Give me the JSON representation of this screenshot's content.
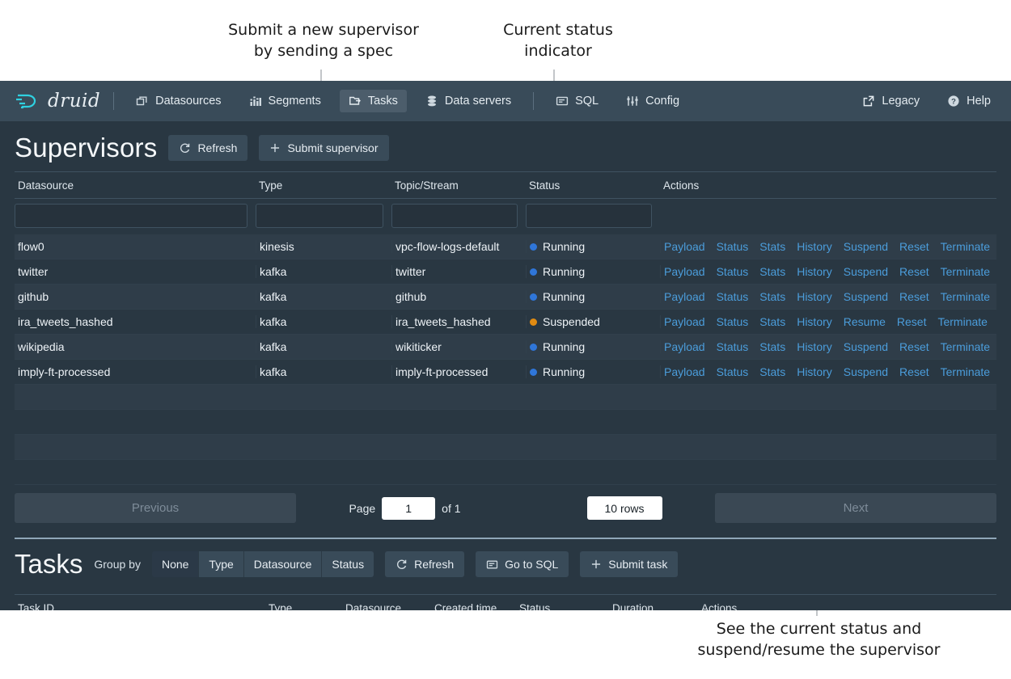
{
  "annotations": [
    {
      "id": "submit-supervisor",
      "text": "Submit a new supervisor\nby sending a spec"
    },
    {
      "id": "status-indicator",
      "text": "Current status\nindicator"
    },
    {
      "id": "suspend-resume",
      "text": "See the current status and\nsuspend/resume the supervisor"
    }
  ],
  "navbar": {
    "brand": "druid",
    "brand_logo_icon": "druid-logo-icon",
    "items": [
      {
        "label": "Datasources",
        "icon": "datasources-icon",
        "active": false
      },
      {
        "label": "Segments",
        "icon": "segments-icon",
        "active": false
      },
      {
        "label": "Tasks",
        "icon": "tasks-icon",
        "active": true
      },
      {
        "label": "Data servers",
        "icon": "data-servers-icon",
        "active": false
      },
      {
        "label": "SQL",
        "icon": "sql-icon",
        "active": false
      },
      {
        "label": "Config",
        "icon": "config-icon",
        "active": false
      }
    ],
    "right_items": [
      {
        "label": "Legacy",
        "icon": "external-link-icon"
      },
      {
        "label": "Help",
        "icon": "help-icon"
      }
    ]
  },
  "supervisors": {
    "title": "Supervisors",
    "refresh_label": "Refresh",
    "refresh_icon": "refresh-icon",
    "submit_label": "Submit supervisor",
    "submit_icon": "plus-icon",
    "columns": [
      "Datasource",
      "Type",
      "Topic/Stream",
      "Status",
      "Actions"
    ],
    "filters": [
      "",
      "",
      "",
      ""
    ],
    "filter_placeholder": "",
    "rows": [
      {
        "datasource": "flow0",
        "type": "kinesis",
        "topic": "vpc-flow-logs-default",
        "status": "Running",
        "status_color": "#2f76d9",
        "actions": [
          "Payload",
          "Status",
          "Stats",
          "History",
          "Suspend",
          "Reset",
          "Terminate"
        ]
      },
      {
        "datasource": "twitter",
        "type": "kafka",
        "topic": "twitter",
        "status": "Running",
        "status_color": "#2f76d9",
        "actions": [
          "Payload",
          "Status",
          "Stats",
          "History",
          "Suspend",
          "Reset",
          "Terminate"
        ]
      },
      {
        "datasource": "github",
        "type": "kafka",
        "topic": "github",
        "status": "Running",
        "status_color": "#2f76d9",
        "actions": [
          "Payload",
          "Status",
          "Stats",
          "History",
          "Suspend",
          "Reset",
          "Terminate"
        ]
      },
      {
        "datasource": "ira_tweets_hashed",
        "type": "kafka",
        "topic": "ira_tweets_hashed",
        "status": "Suspended",
        "status_color": "#e08b12",
        "actions": [
          "Payload",
          "Status",
          "Stats",
          "History",
          "Resume",
          "Reset",
          "Terminate"
        ]
      },
      {
        "datasource": "wikipedia",
        "type": "kafka",
        "topic": "wikiticker",
        "status": "Running",
        "status_color": "#2f76d9",
        "actions": [
          "Payload",
          "Status",
          "Stats",
          "History",
          "Suspend",
          "Reset",
          "Terminate"
        ]
      },
      {
        "datasource": "imply-ft-processed",
        "type": "kafka",
        "topic": "imply-ft-processed",
        "status": "Running",
        "status_color": "#2f76d9",
        "actions": [
          "Payload",
          "Status",
          "Stats",
          "History",
          "Suspend",
          "Reset",
          "Terminate"
        ]
      }
    ],
    "empty_row_count": 4,
    "pagination": {
      "previous_label": "Previous",
      "next_label": "Next",
      "page_label": "Page",
      "page_value": "1",
      "of_label": "of 1",
      "rows_value": "10 rows"
    }
  },
  "tasks": {
    "title": "Tasks",
    "group_by_label": "Group by",
    "group_by_options": [
      {
        "label": "None",
        "selected": true
      },
      {
        "label": "Type",
        "selected": false
      },
      {
        "label": "Datasource",
        "selected": false
      },
      {
        "label": "Status",
        "selected": false
      }
    ],
    "refresh_label": "Refresh",
    "refresh_icon": "refresh-icon",
    "go_to_sql_label": "Go to SQL",
    "go_to_sql_icon": "sql-icon",
    "submit_task_label": "Submit task",
    "submit_task_icon": "plus-icon",
    "columns": [
      "Task ID",
      "Type",
      "Datasource",
      "Created time",
      "Status",
      "Duration",
      "Actions"
    ]
  },
  "colors": {
    "navbar_bg": "#394b59",
    "app_bg": "#293742",
    "link_blue": "#4b9ddb",
    "running_blue": "#2f76d9",
    "suspended_orange": "#e08b12",
    "brand_cyan": "#2fd0e0"
  }
}
